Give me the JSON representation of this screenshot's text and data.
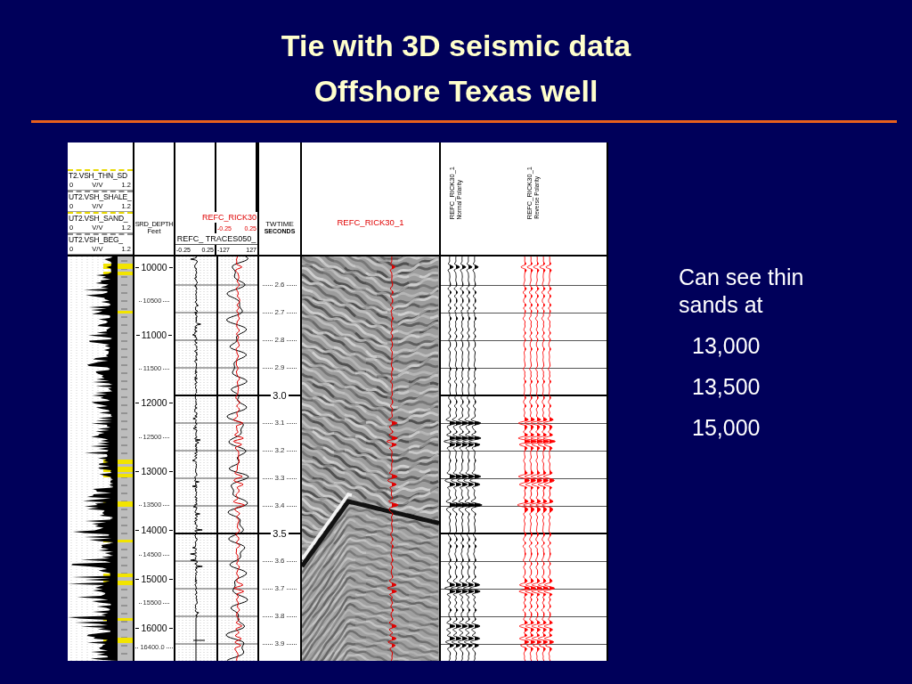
{
  "slide": {
    "title": "Tie with 3D seismic data",
    "subtitle": "Offshore Texas well"
  },
  "well_section": {
    "vsh_track": {
      "curves": [
        {
          "name": "T2.VSH_THN_SD",
          "color": "#e8d800",
          "scale_min": "0",
          "scale_unit": "V/V",
          "scale_max": "1.2"
        },
        {
          "name": "UT2.VSH_SHALE_",
          "color": "#8c8c8c",
          "scale_min": "0",
          "scale_unit": "V/V",
          "scale_max": "1.2"
        },
        {
          "name": "UT2.VSH_SAND_",
          "color": "#e8d800",
          "scale_min": "0",
          "scale_unit": "V/V",
          "scale_max": "1.2"
        },
        {
          "name": "UT2.VSH_BEG_",
          "color": "#8c8c8c",
          "scale_min": "0",
          "scale_unit": "V/V",
          "scale_max": "1.2"
        }
      ]
    },
    "depth_track": {
      "title": "SRD_DEPTH",
      "unit": "Feet",
      "ticks": [
        {
          "label": "10000",
          "kind": "major"
        },
        {
          "label": "10500",
          "kind": "minor"
        },
        {
          "label": "11000",
          "kind": "major"
        },
        {
          "label": "11500",
          "kind": "minor"
        },
        {
          "label": "12000",
          "kind": "major"
        },
        {
          "label": "12500",
          "kind": "minor"
        },
        {
          "label": "13000",
          "kind": "major"
        },
        {
          "label": "13500",
          "kind": "minor"
        },
        {
          "label": "14000",
          "kind": "major"
        },
        {
          "label": "14500",
          "kind": "minor"
        },
        {
          "label": "15000",
          "kind": "major"
        },
        {
          "label": "15500",
          "kind": "minor"
        },
        {
          "label": "16000",
          "kind": "major"
        },
        {
          "label": "16400.0",
          "kind": "minor"
        }
      ]
    },
    "trace_tracks": {
      "overlay_curve": {
        "name": "REFC_RICK30",
        "scale_min": "-0.25",
        "scale_max": "0.25"
      },
      "label": "REFC_ TRACES050_",
      "scales": [
        {
          "min": "-0.25",
          "max": "0.25"
        },
        {
          "min": "-127",
          "max": "127"
        }
      ]
    },
    "time_track": {
      "title": "TWTIME",
      "unit": "SECONDS",
      "ticks": [
        {
          "label": "2.6",
          "kind": "minor"
        },
        {
          "label": "2.7",
          "kind": "minor"
        },
        {
          "label": "2.8",
          "kind": "minor"
        },
        {
          "label": "2.9",
          "kind": "minor"
        },
        {
          "label": "3.0",
          "kind": "major"
        },
        {
          "label": "3.1",
          "kind": "minor"
        },
        {
          "label": "3.2",
          "kind": "minor"
        },
        {
          "label": "3.3",
          "kind": "minor"
        },
        {
          "label": "3.4",
          "kind": "minor"
        },
        {
          "label": "3.5",
          "kind": "major"
        },
        {
          "label": "3.6",
          "kind": "minor"
        },
        {
          "label": "3.7",
          "kind": "minor"
        },
        {
          "label": "3.8",
          "kind": "minor"
        },
        {
          "label": "3.9",
          "kind": "minor"
        }
      ]
    },
    "seismic_track": {
      "title": "REFC_RICK30_1"
    },
    "synthetic_panels": [
      {
        "name": "REFC_RICK30_1",
        "polarity": "Normal Polarity",
        "color": "#000000"
      },
      {
        "name": "REFC_RICK30_1",
        "polarity": "Reverse Polarity",
        "color": "#ff0000"
      }
    ]
  },
  "notes": {
    "text": "Can see thin sands at",
    "depths": [
      "13,000",
      "13,500",
      "15,000"
    ]
  }
}
